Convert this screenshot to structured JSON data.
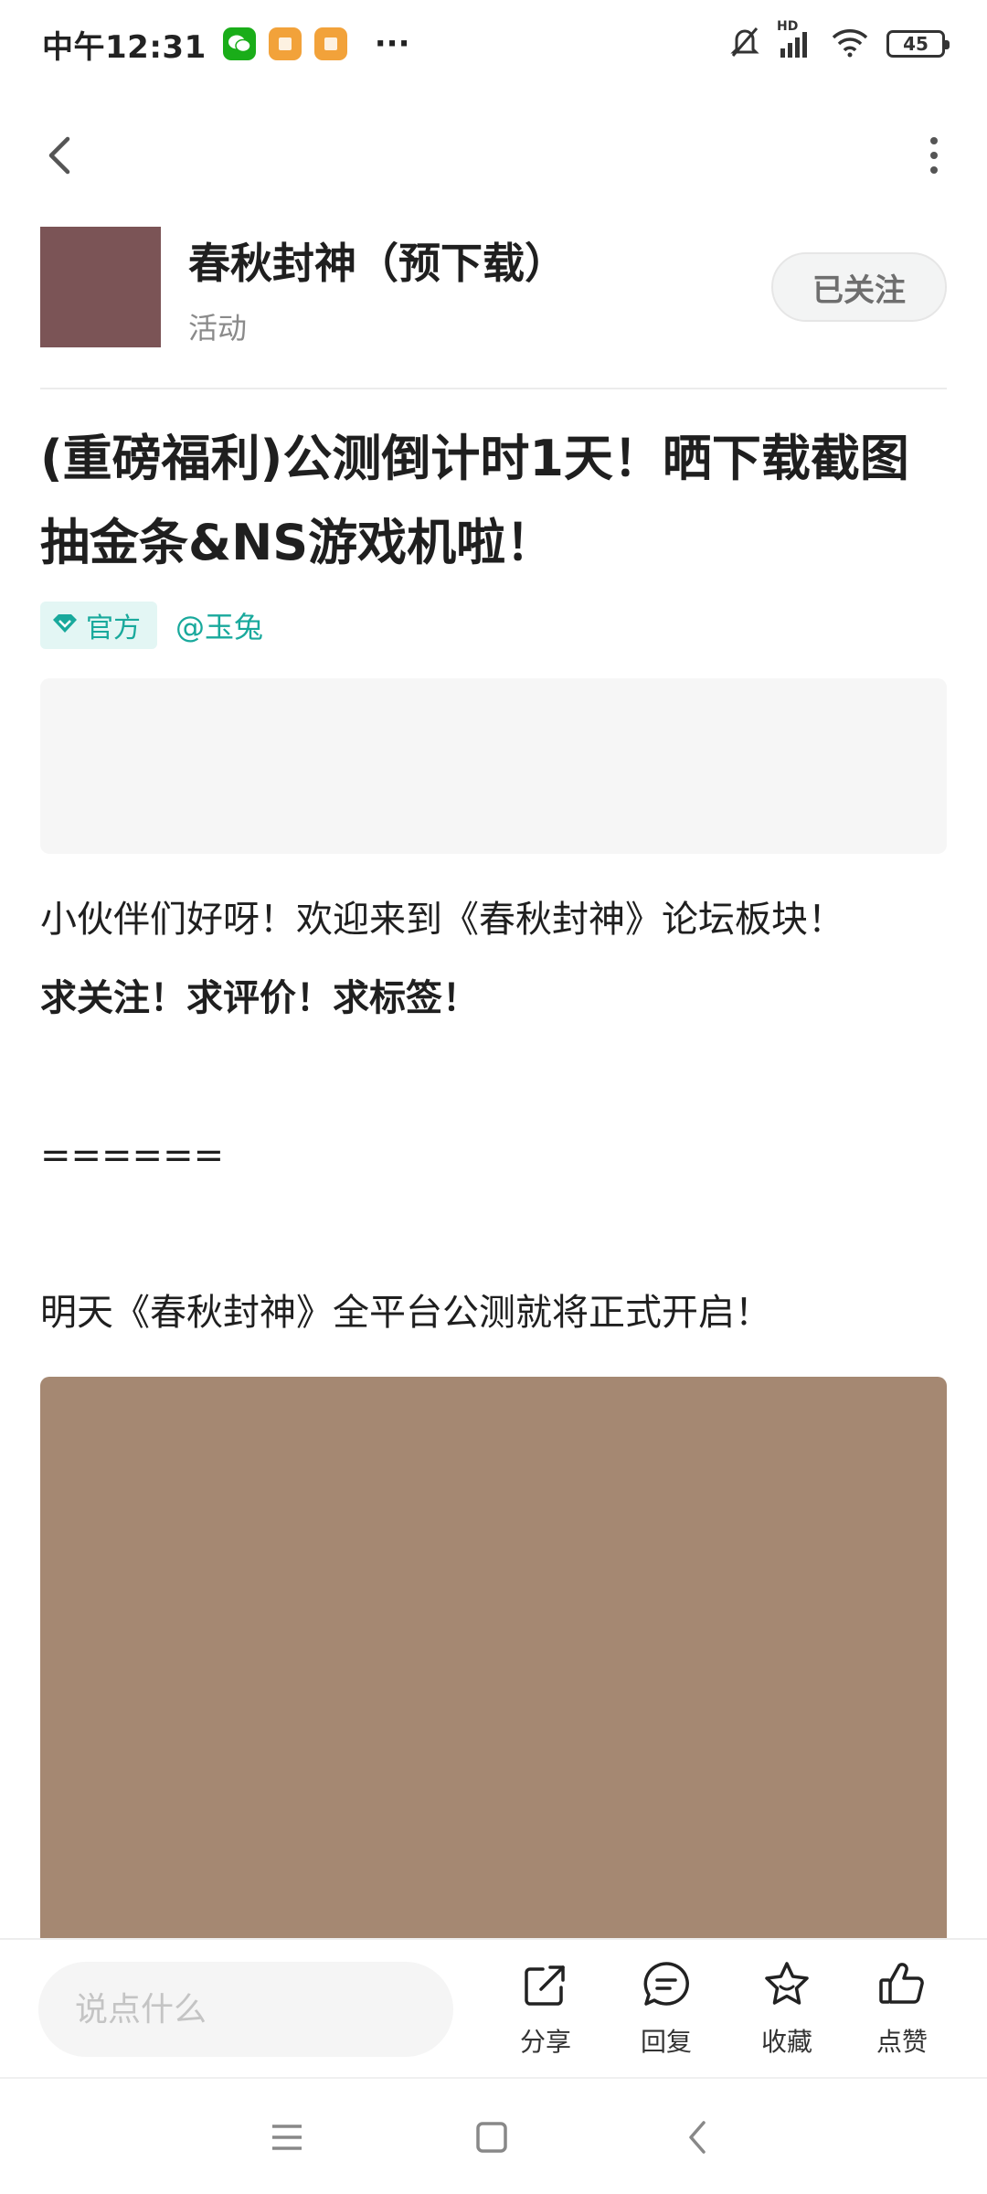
{
  "status_bar": {
    "time": "中午12:31",
    "more": "···",
    "battery": "45",
    "network": "HD"
  },
  "forum": {
    "name": "春秋封神（预下载）",
    "subtitle": "活动",
    "follow_label": "已关注"
  },
  "post": {
    "title": "(重磅福利)公测倒计时1天！晒下载截图抽金条&NS游戏机啦！",
    "official_tag": "官方",
    "author": "@玉兔",
    "paragraphs": [
      "小伙伴们好呀！欢迎来到《春秋封神》论坛板块！",
      "求关注！求评价！求标签！",
      "======",
      "明天《春秋封神》全平台公测就将正式开启！"
    ]
  },
  "action_bar": {
    "input_placeholder": "说点什么",
    "share": "分享",
    "reply": "回复",
    "favorite": "收藏",
    "like": "点赞"
  },
  "colors": {
    "accent": "#19A99C",
    "forum_avatar": "#7B5456",
    "post_image": "#A58872"
  },
  "icons": {
    "back": "chevron-left-icon",
    "more": "more-vertical-icon",
    "share": "share-icon",
    "reply": "comment-icon",
    "favorite": "star-icon",
    "like": "thumbs-up-icon"
  }
}
